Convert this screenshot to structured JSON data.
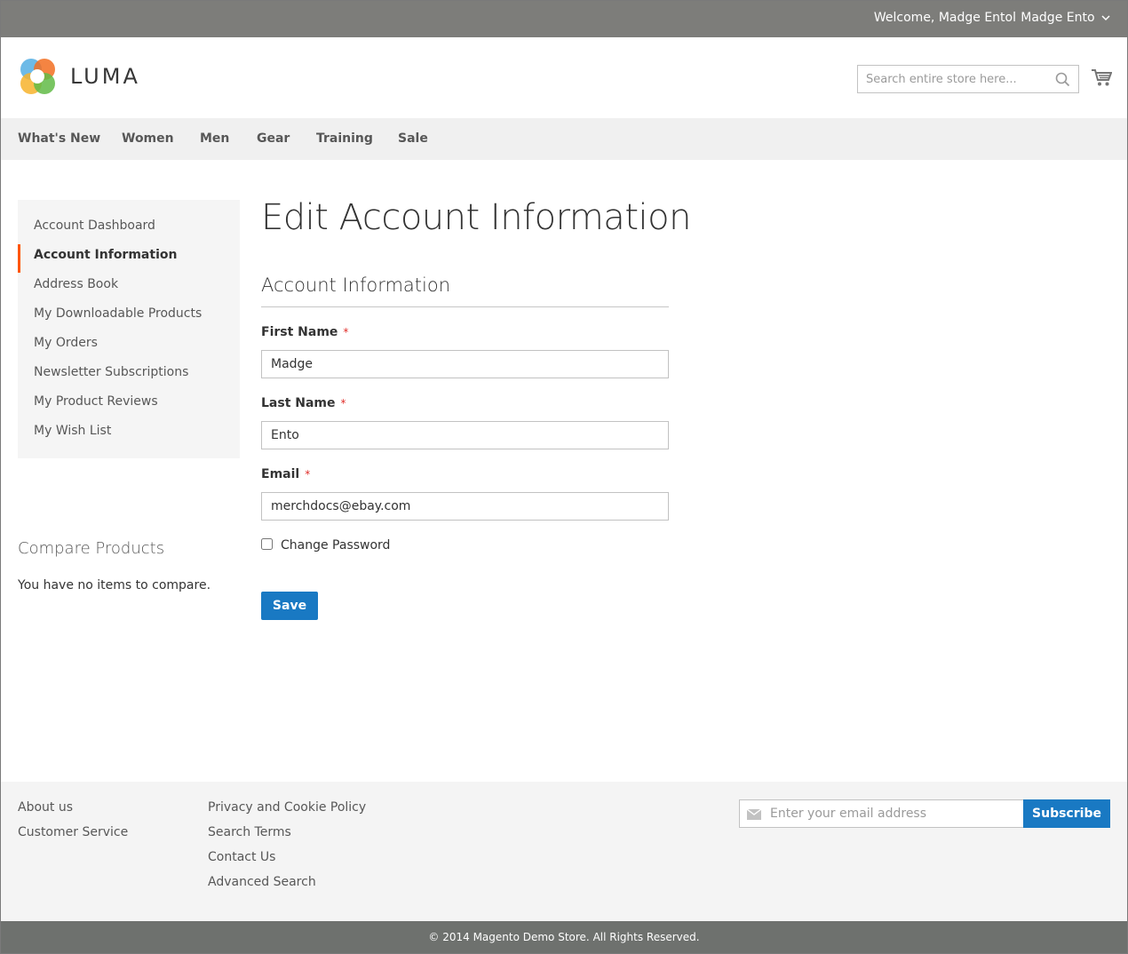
{
  "top_panel": {
    "welcome": "Welcome, Madge Entol",
    "account_name": "Madge Ento"
  },
  "header": {
    "logo_text": "LUMA",
    "search_placeholder": "Search entire store here..."
  },
  "nav": {
    "items": [
      "What's New",
      "Women",
      "Men",
      "Gear",
      "Training",
      "Sale"
    ]
  },
  "sidebar": {
    "items": [
      "Account Dashboard",
      "Account Information",
      "Address Book",
      "My Downloadable Products",
      "My Orders",
      "Newsletter Subscriptions",
      "My Product Reviews",
      "My Wish List"
    ],
    "current": "Account Information",
    "compare_title": "Compare Products",
    "compare_empty": "You have no items to compare."
  },
  "main": {
    "page_title": "Edit Account Information",
    "legend": "Account Information",
    "first_name_label": "First Name",
    "first_name_value": "Madge",
    "last_name_label": "Last Name",
    "last_name_value": "Ento",
    "email_label": "Email",
    "email_value": "merchdocs@ebay.com",
    "required_mark": "*",
    "change_password_label": "Change Password",
    "change_password_checked": false,
    "save_label": "Save"
  },
  "footer": {
    "col1": [
      "About us",
      "Customer Service"
    ],
    "col2": [
      "Privacy and Cookie Policy",
      "Search Terms",
      "Contact Us",
      "Advanced Search"
    ],
    "newsletter_placeholder": "Enter your email address",
    "subscribe_label": "Subscribe",
    "copyright": "© 2014 Magento Demo Store. All Rights Reserved."
  },
  "colors": {
    "accent_blue": "#1979c3",
    "current_marker": "#ff5501",
    "top_panel": "#7d7d7a",
    "required": "#e02b27"
  }
}
